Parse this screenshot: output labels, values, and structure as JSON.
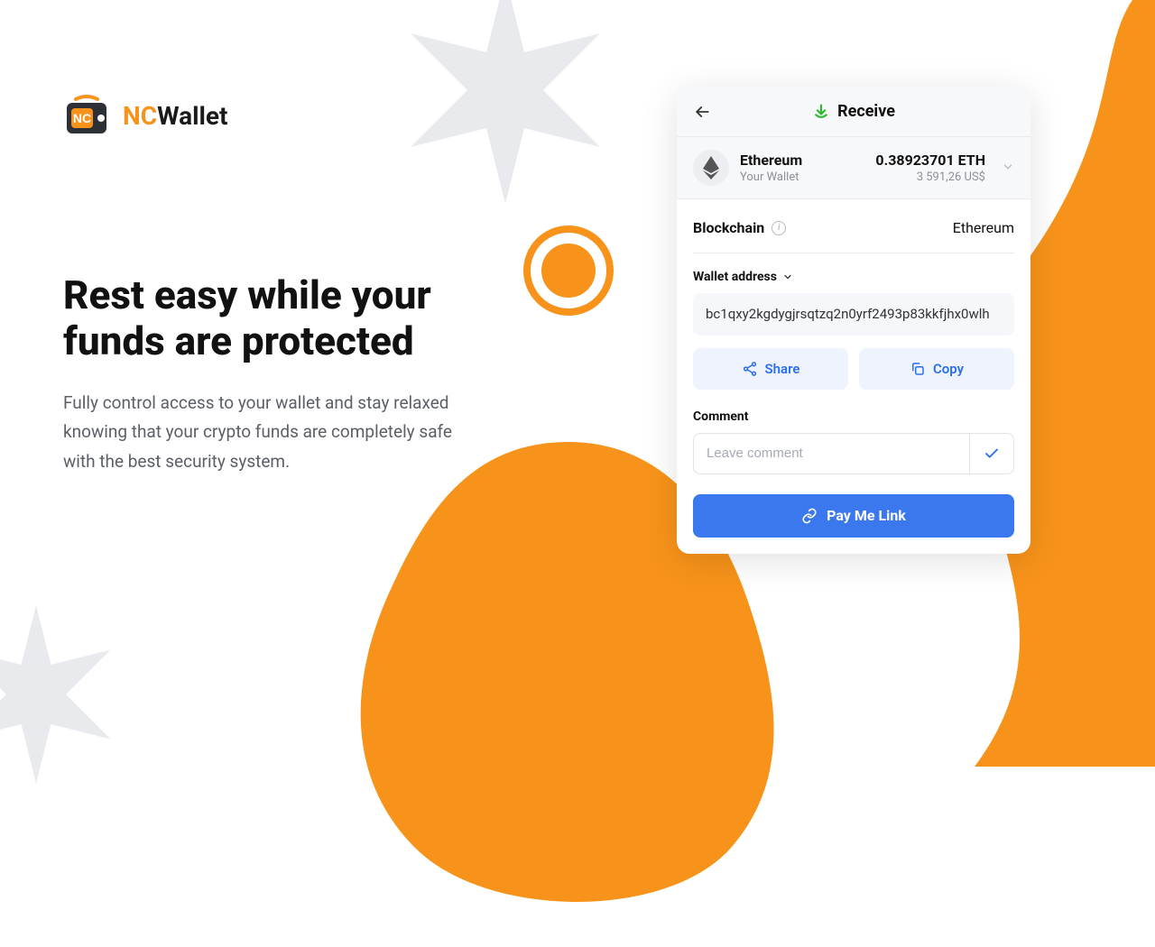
{
  "brand": {
    "prefix": "NC",
    "suffix": "Wallet"
  },
  "hero": {
    "headline": "Rest easy while your funds are protected",
    "subtext": "Fully control access to your wallet and stay relaxed knowing that your crypto funds are completely safe with the best security system."
  },
  "card": {
    "title": "Receive",
    "asset": {
      "name": "Ethereum",
      "subtitle": "Your Wallet",
      "amount": "0.38923701 ETH",
      "fiat": "3 591,26 US$"
    },
    "blockchain": {
      "label": "Blockchain",
      "value": "Ethereum"
    },
    "address": {
      "label": "Wallet address",
      "value": "bc1qxy2kgdygjrsqtzq2n0yrf2493p83kkfjhx0wlh"
    },
    "actions": {
      "share": "Share",
      "copy": "Copy"
    },
    "comment": {
      "label": "Comment",
      "placeholder": "Leave comment"
    },
    "payme": "Pay Me Link"
  }
}
